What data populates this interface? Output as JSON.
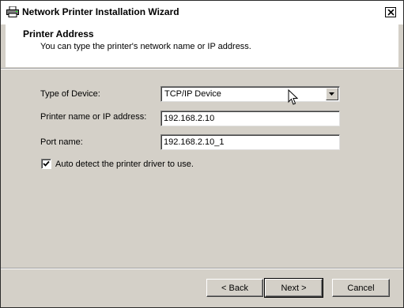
{
  "window": {
    "title": "Network Printer Installation Wizard",
    "icon": "printer-icon",
    "close_icon": "close-icon"
  },
  "header": {
    "title": "Printer Address",
    "subtitle": "You can type the printer's network name or IP address."
  },
  "form": {
    "device_type_label": "Type of Device:",
    "device_type_value": "TCP/IP Device",
    "printer_name_label": "Printer name or IP address:",
    "printer_name_value": "192.168.2.10",
    "port_name_label": "Port name:",
    "port_name_value": "192.168.2.10_1",
    "auto_detect_label": "Auto detect the printer driver to use.",
    "auto_detect_checked": true
  },
  "buttons": {
    "back": "< Back",
    "next": "Next >",
    "cancel": "Cancel"
  },
  "colors": {
    "dialog_bg": "#d4d0c8",
    "header_bg": "#ffffff"
  }
}
